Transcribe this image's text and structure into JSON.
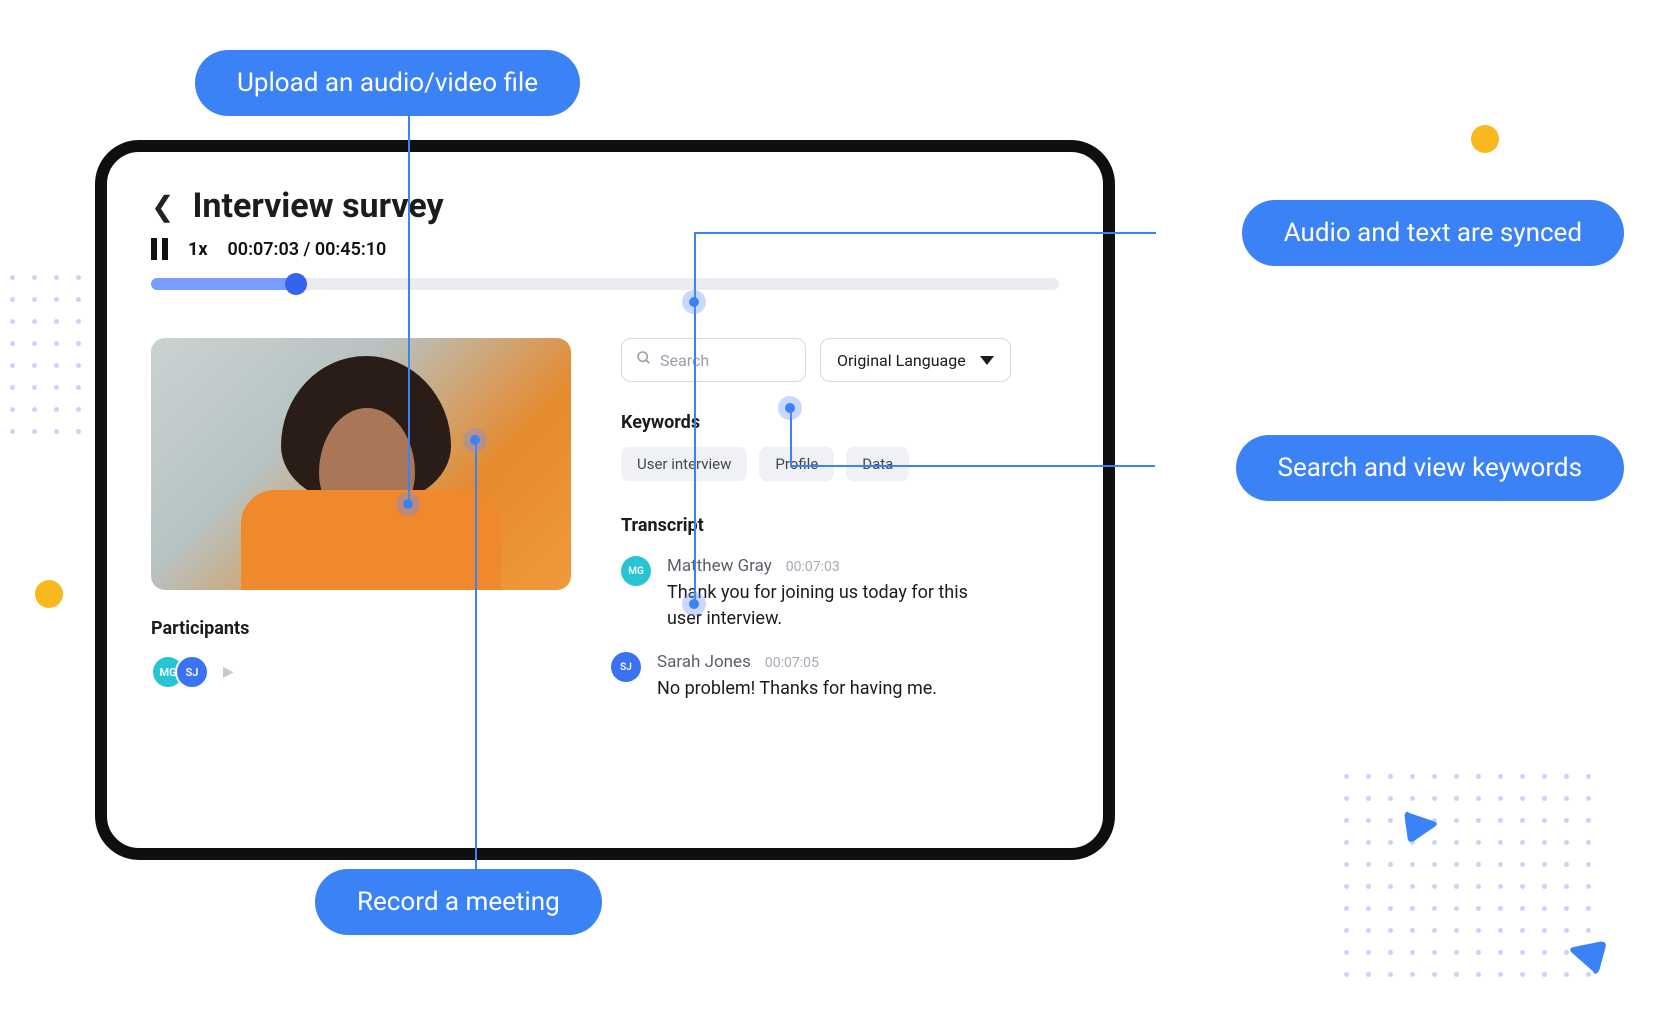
{
  "callouts": {
    "upload": "Upload an audio/video file",
    "record": "Record a meeting",
    "synced": "Audio and text are synced",
    "search_keywords": "Search and view keywords"
  },
  "header": {
    "title": "Interview survey"
  },
  "player": {
    "speed": "1x",
    "current_time": "00:07:03",
    "total_time": "00:45:10",
    "progress_pct": 16
  },
  "participants": {
    "heading": "Participants",
    "list": [
      {
        "initials": "MG",
        "class": "mg"
      },
      {
        "initials": "SJ",
        "class": "sj"
      }
    ]
  },
  "search": {
    "placeholder": "Search"
  },
  "language": {
    "selected": "Original Language"
  },
  "keywords": {
    "heading": "Keywords",
    "items": [
      "User interview",
      "Profile",
      "Data"
    ]
  },
  "transcript": {
    "heading": "Transcript",
    "entries": [
      {
        "initials": "MG",
        "avatar_class": "mg",
        "name": "Matthew Gray",
        "time": "00:07:03",
        "text": "Thank you for joining us today for this user interview."
      },
      {
        "initials": "SJ",
        "avatar_class": "sj",
        "name": "Sarah Jones",
        "time": "00:07:05",
        "text": "No problem! Thanks for having me."
      }
    ]
  }
}
